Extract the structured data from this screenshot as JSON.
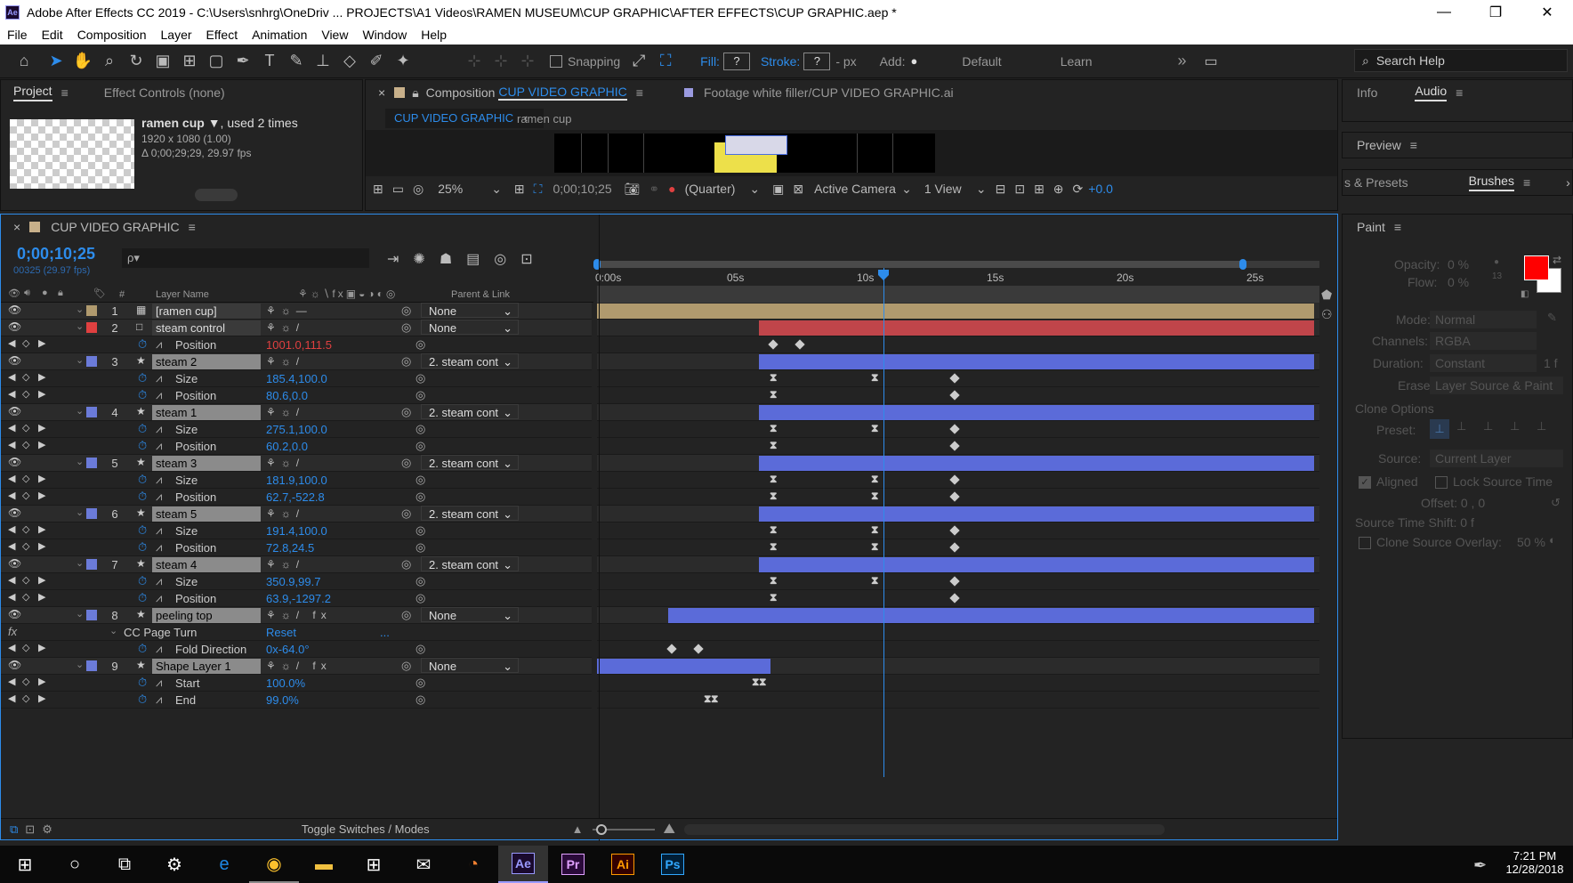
{
  "window": {
    "title": "Adobe After Effects CC 2019 - C:\\Users\\snhrg\\OneDriv ... PROJECTS\\A1 Videos\\RAMEN MUSEUM\\CUP GRAPHIC\\AFTER EFFECTS\\CUP GRAPHIC.aep *",
    "min": "—",
    "max": "❐",
    "close": "✕",
    "app_icon": "Ae"
  },
  "menu": [
    "File",
    "Edit",
    "Composition",
    "Layer",
    "Effect",
    "Animation",
    "View",
    "Window",
    "Help"
  ],
  "toolbar": {
    "snapping": "Snapping",
    "fill": "Fill:",
    "fill_val": "?",
    "stroke": "Stroke:",
    "stroke_val": "?",
    "px": "-  px",
    "add": "Add:",
    "workspace_default": "Default",
    "workspace_learn": "Learn",
    "more": "»",
    "search_help": "Search Help"
  },
  "project_panel": {
    "tab_project": "Project",
    "tab_effects": "Effect Controls (none)",
    "item_name": "ramen cup ▼",
    "item_used": ", used 2 times",
    "item_size": "1920 x 1080 (1.00)",
    "item_dur": "Δ 0;00;29;29, 29.97 fps"
  },
  "comp_panel": {
    "close": "×",
    "label": "Composition",
    "comp_name": "CUP VIDEO GRAPHIC",
    "footage": "Footage  white filler/CUP VIDEO GRAPHIC.ai",
    "crumb1": "CUP VIDEO GRAPHIC",
    "crumb2": "ramen cup",
    "zoom": "25%",
    "timecode": "0;00;10;25",
    "quality": "(Quarter)",
    "camera": "Active Camera",
    "views": "1 View",
    "exposure": "+0.0"
  },
  "right_panel": {
    "info": "Info",
    "audio": "Audio",
    "preview": "Preview",
    "presets": "s & Presets",
    "brushes": "Brushes",
    "paint": "Paint",
    "opacity": "Opacity:",
    "opacity_val": "0 %",
    "flow": "Flow:",
    "flow_val": "0 %",
    "mode": "Mode:",
    "mode_val": "Normal",
    "channels": "Channels:",
    "channels_val": "RGBA",
    "duration": "Duration:",
    "duration_val": "Constant",
    "duration_f": "1  f",
    "erase": "Erase:",
    "erase_val": "Layer Source & Paint",
    "clone_options": "Clone Options",
    "preset": "Preset:",
    "source": "Source:",
    "source_val": "Current Layer",
    "aligned": "Aligned",
    "lock_source": "Lock Source Time",
    "offset": "Offset:  0 ,          0",
    "shift": "Source Time Shift:  0  f",
    "overlay": "Clone Source Overlay:",
    "overlay_val": "50 %",
    "small_val": "13",
    "fg_color": "#ff0000",
    "bg_color": "#ffffff"
  },
  "timeline": {
    "close": "×",
    "comp_name": "CUP VIDEO GRAPHIC",
    "timecode": "0;00;10;25",
    "frames": "00325 (29.97 fps)",
    "search_icon": "ρ▾",
    "col_layer": "Layer Name",
    "col_num": "#",
    "col_parent": "Parent & Link",
    "ruler": [
      "0:00s",
      "05s",
      "10s",
      "15s",
      "20s",
      "25s"
    ],
    "toggle": "Toggle Switches / Modes",
    "rows": [
      {
        "kind": "layer",
        "num": "1",
        "name": "[ramen cup]",
        "color": "#b09a6e",
        "parent": "None",
        "sw": "— ",
        "plain": true
      },
      {
        "kind": "layer",
        "num": "2",
        "name": "steam control",
        "color": "#e04040",
        "parent": "None",
        "sw": "/",
        "plain": true
      },
      {
        "kind": "prop",
        "name": "Position",
        "value": "1001.0,111.5",
        "vcolor": "#e04040"
      },
      {
        "kind": "layer",
        "num": "3",
        "name": "steam 2",
        "color": "#6b7bd9",
        "parent": "2. steam cont",
        "sw": "/"
      },
      {
        "kind": "prop",
        "name": "Size",
        "value": "185.4,100.0",
        "vcolor": "#2d8ceb"
      },
      {
        "kind": "prop",
        "name": "Position",
        "value": "80.6,0.0",
        "vcolor": "#2d8ceb"
      },
      {
        "kind": "layer",
        "num": "4",
        "name": "steam 1",
        "color": "#6b7bd9",
        "parent": "2. steam cont",
        "sw": "/"
      },
      {
        "kind": "prop",
        "name": "Size",
        "value": "275.1,100.0",
        "vcolor": "#2d8ceb"
      },
      {
        "kind": "prop",
        "name": "Position",
        "value": "60.2,0.0",
        "vcolor": "#2d8ceb"
      },
      {
        "kind": "layer",
        "num": "5",
        "name": "steam 3",
        "color": "#6b7bd9",
        "parent": "2. steam cont",
        "sw": "/"
      },
      {
        "kind": "prop",
        "name": "Size",
        "value": "181.9,100.0",
        "vcolor": "#2d8ceb"
      },
      {
        "kind": "prop",
        "name": "Position",
        "value": "62.7,-522.8",
        "vcolor": "#2d8ceb"
      },
      {
        "kind": "layer",
        "num": "6",
        "name": "steam 5",
        "color": "#6b7bd9",
        "parent": "2. steam cont",
        "sw": "/"
      },
      {
        "kind": "prop",
        "name": "Size",
        "value": "191.4,100.0",
        "vcolor": "#2d8ceb"
      },
      {
        "kind": "prop",
        "name": "Position",
        "value": "72.8,24.5",
        "vcolor": "#2d8ceb"
      },
      {
        "kind": "layer",
        "num": "7",
        "name": "steam 4",
        "color": "#6b7bd9",
        "parent": "2. steam cont",
        "sw": "/"
      },
      {
        "kind": "prop",
        "name": "Size",
        "value": "350.9,99.7",
        "vcolor": "#2d8ceb"
      },
      {
        "kind": "prop",
        "name": "Position",
        "value": "63.9,-1297.2",
        "vcolor": "#2d8ceb"
      },
      {
        "kind": "layer",
        "num": "8",
        "name": "peeling top",
        "color": "#6b7bd9",
        "parent": "None",
        "sw": "/ fx"
      },
      {
        "kind": "effect",
        "name": "CC Page Turn",
        "value": "Reset",
        "vcolor": "#2d8ceb"
      },
      {
        "kind": "prop",
        "name": "Fold Direction",
        "value": "0x-64.0°",
        "vcolor": "#2d8ceb"
      },
      {
        "kind": "layer",
        "num": "9",
        "name": "Shape Layer 1",
        "color": "#6b7bd9",
        "parent": "None",
        "sw": "/ fx"
      },
      {
        "kind": "prop",
        "name": "Start",
        "value": "100.0%",
        "vcolor": "#2d8ceb"
      },
      {
        "kind": "prop",
        "name": "End",
        "value": "99.0%",
        "vcolor": "#2d8ceb"
      }
    ]
  },
  "taskbar": {
    "ae": "Ae",
    "pr": "Pr",
    "ai": "Ai",
    "ps": "Ps",
    "time": "7:21 PM",
    "date": "12/28/2018"
  }
}
